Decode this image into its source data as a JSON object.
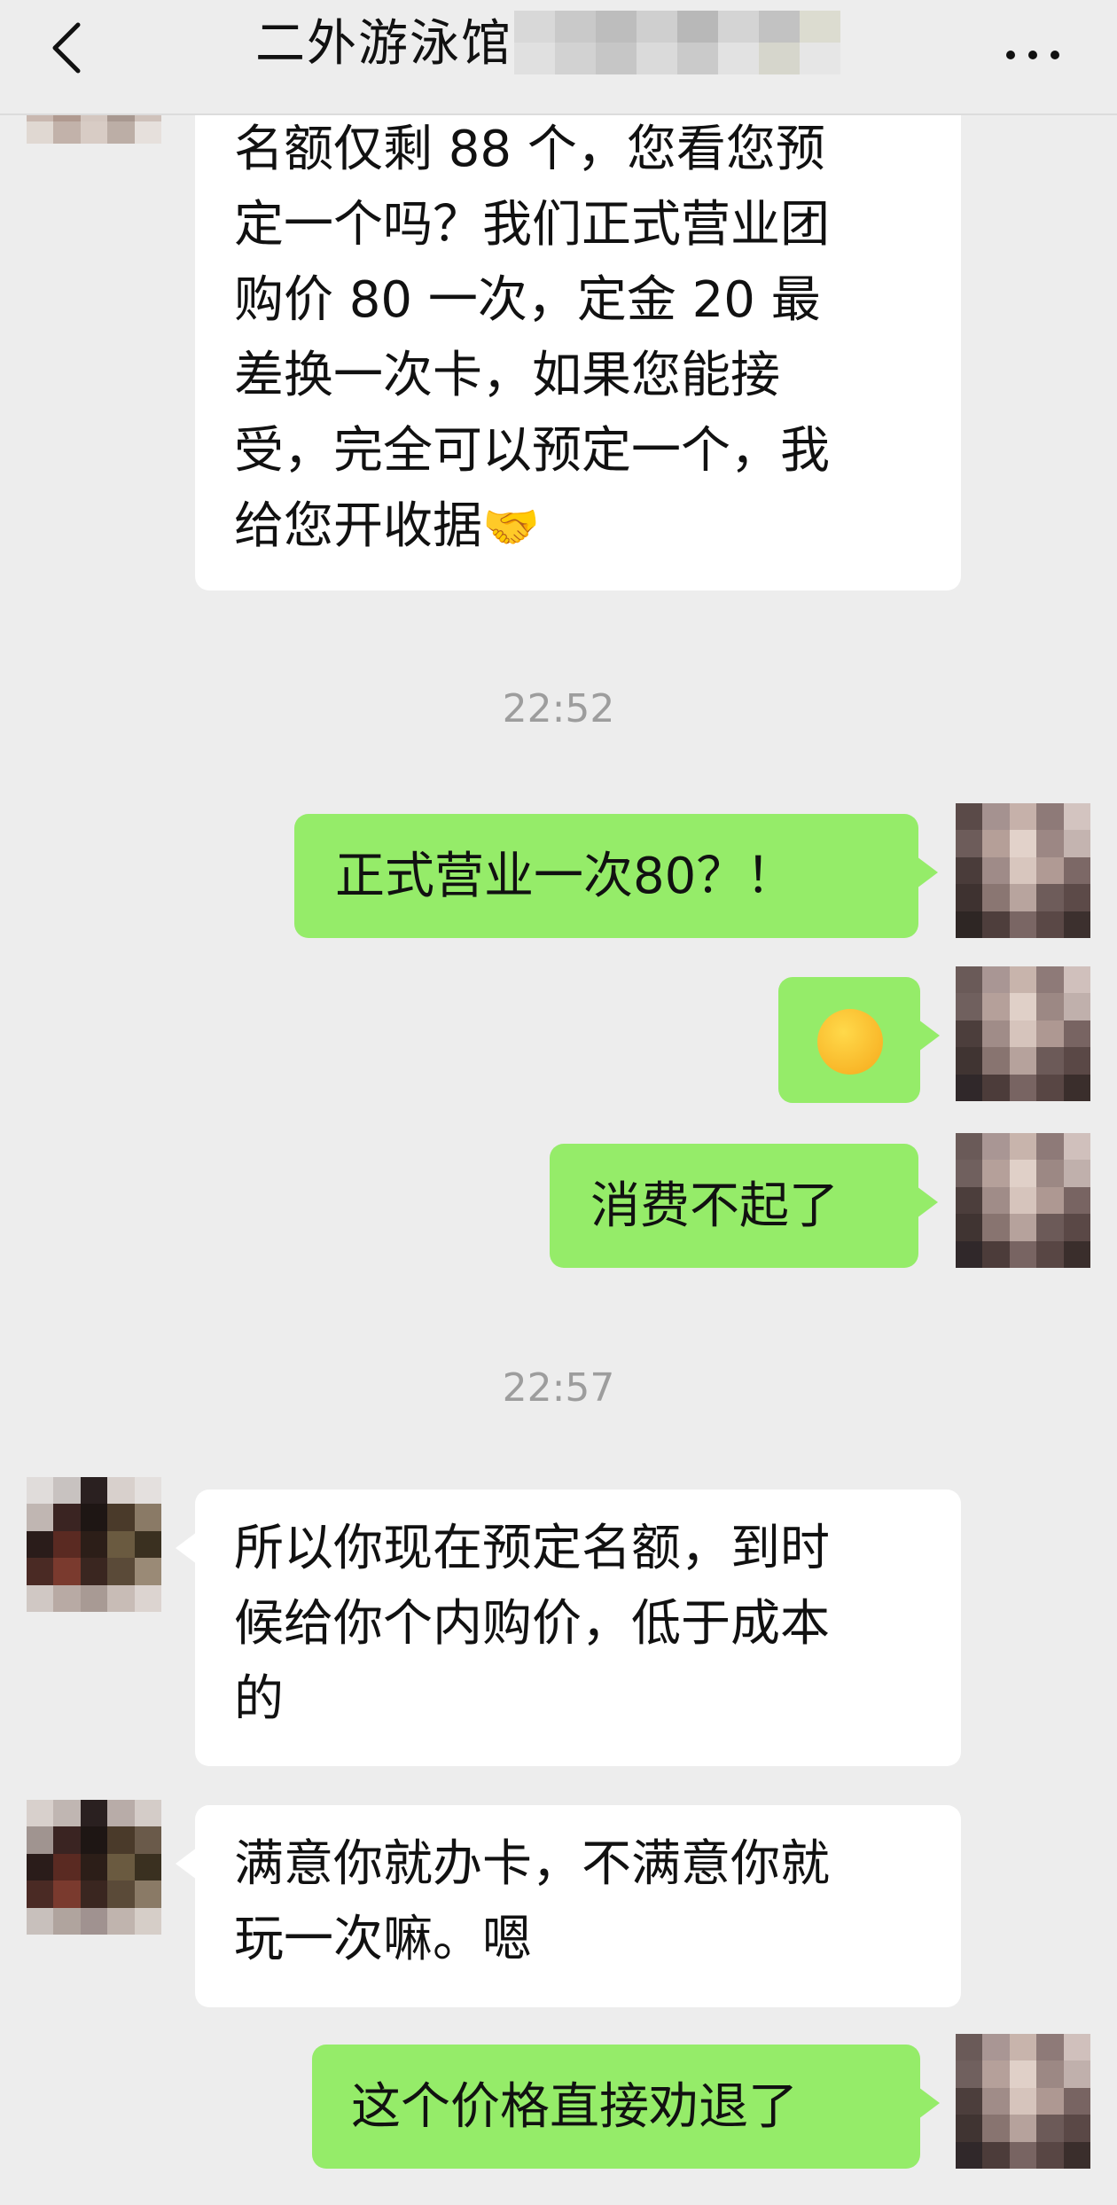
{
  "header": {
    "back_icon": "chevron-left-icon",
    "title": "二外游泳馆",
    "more_icon": "more-dots-icon"
  },
  "colors": {
    "background": "#ededed",
    "incoming_bubble": "#ffffff",
    "outgoing_bubble": "#95ec69"
  },
  "messages": {
    "m1": {
      "lines": [
        "名额仅剩 88 个，您看您预",
        "定一个吗？我们正式营业团",
        "购价 80 一次，定金 20 最",
        "差换一次卡，如果您能接",
        "受，完全可以预定一个，我",
        "给您开收据"
      ],
      "emoji": "🤝"
    },
    "time1": "22:52",
    "m2": {
      "text": "正式营业一次80？！"
    },
    "m3": {
      "emoji": "🤣"
    },
    "m4": {
      "text": "消费不起了"
    },
    "time2": "22:57",
    "m5": {
      "lines": [
        "所以你现在预定名额，到时",
        "候给你个内购价，低于成本",
        "的"
      ]
    },
    "m6": {
      "lines": [
        "满意你就办卡，不满意你就",
        "玩一次嘛。嗯"
      ]
    },
    "m7": {
      "text": "这个价格直接劝退了"
    }
  }
}
